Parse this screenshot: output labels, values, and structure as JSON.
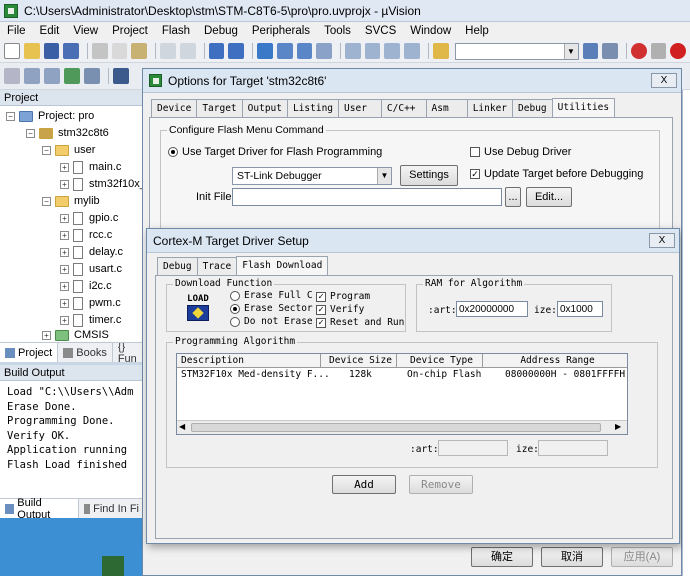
{
  "window": {
    "title": "C:\\Users\\Administrator\\Desktop\\stm\\STM-C8T6-5\\pro\\pro.uvprojx - µVision"
  },
  "menu": [
    "File",
    "Edit",
    "View",
    "Project",
    "Flash",
    "Debug",
    "Peripherals",
    "Tools",
    "SVCS",
    "Window",
    "Help"
  ],
  "project_panel": {
    "header": "Project",
    "root": "Project: pro",
    "target": "stm32c8t6",
    "items": [
      {
        "label": "user",
        "type": "folder"
      },
      {
        "label": "main.c",
        "type": "file"
      },
      {
        "label": "stm32f10x_",
        "type": "file"
      },
      {
        "label": "mylib",
        "type": "folder"
      },
      {
        "label": "gpio.c",
        "type": "file"
      },
      {
        "label": "rcc.c",
        "type": "file"
      },
      {
        "label": "delay.c",
        "type": "file"
      },
      {
        "label": "usart.c",
        "type": "file"
      },
      {
        "label": "i2c.c",
        "type": "file"
      },
      {
        "label": "pwm.c",
        "type": "file"
      },
      {
        "label": "timer.c",
        "type": "file"
      },
      {
        "label": "CMSIS",
        "type": "folder"
      }
    ],
    "tabs": [
      "Project",
      "Books",
      "{} Fun"
    ]
  },
  "build_output": {
    "header": "Build Output",
    "lines": [
      "Load \"C:\\\\Users\\\\Adm",
      "Erase Done.",
      "Programming Done.",
      "Verify OK.",
      "Application running",
      "Flash Load finished"
    ],
    "tabs": [
      "Build Output",
      "Find In Fi"
    ]
  },
  "options_dialog": {
    "title": "Options for Target 'stm32c8t6'",
    "close": "X",
    "tabs": [
      "Device",
      "Target",
      "Output",
      "Listing",
      "User",
      "C/C++",
      "Asm",
      "Linker",
      "Debug",
      "Utilities"
    ],
    "group_label": "Configure Flash Menu Command",
    "use_target_driver": "Use Target Driver for Flash Programming",
    "driver": "ST-Link Debugger",
    "settings": "Settings",
    "use_debug_driver": "Use Debug Driver",
    "update_target": "Update Target before Debugging",
    "init_file": "Init File:",
    "browse": "...",
    "edit": "Edit...",
    "ok": "确定",
    "cancel": "取消",
    "apply": "应用(A)"
  },
  "driver_dialog": {
    "title": "Cortex-M Target Driver Setup",
    "close": "X",
    "tabs": [
      "Debug",
      "Trace",
      "Flash Download"
    ],
    "download_function": {
      "label": "Download Function",
      "logo_top": "LOAD",
      "options": [
        "Erase Full C",
        "Erase Sector",
        "Do not Erase"
      ],
      "selected": "Erase Sector",
      "checks": [
        {
          "label": "Program",
          "checked": true
        },
        {
          "label": "Verify",
          "checked": true
        },
        {
          "label": "Reset and Run",
          "checked": true
        }
      ]
    },
    "ram": {
      "label": "RAM for Algorithm",
      "start_label": ":art:",
      "start_value": "0x20000000",
      "size_label": "ize:",
      "size_value": "0x1000"
    },
    "algorithm": {
      "label": "Programming Algorithm",
      "columns": [
        "Description",
        "Device Size",
        "Device Type",
        "Address Range"
      ],
      "rows": [
        [
          "STM32F10x Med-density F...",
          "128k",
          "On-chip Flash",
          "08000000H - 0801FFFFH"
        ]
      ],
      "start_label": ":art:",
      "size_label": "ize:"
    },
    "add": "Add",
    "remove": "Remove"
  },
  "colors": {
    "accent": "#3a6ea5",
    "title_bg": "#dbe6f3",
    "dialog_bg": "#f0f0f0"
  }
}
